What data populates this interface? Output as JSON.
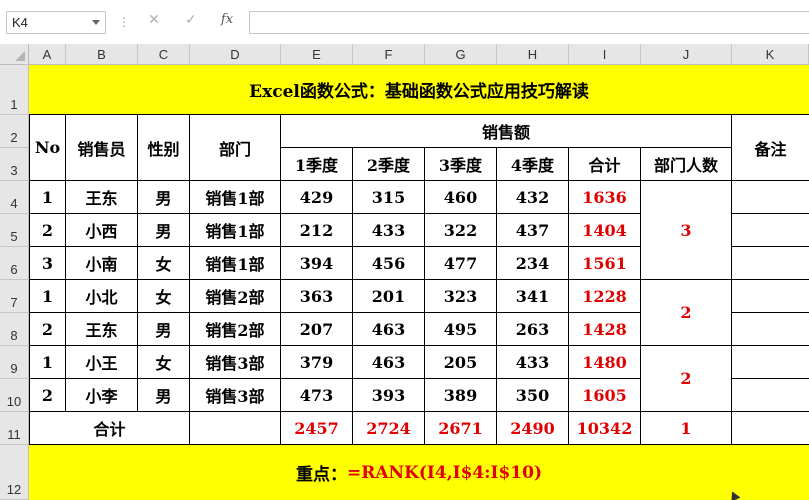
{
  "formula_bar": {
    "name_box": "K4",
    "separator": "⋮",
    "cancel_icon": "✕",
    "enter_icon": "✓",
    "fx_label": "fx",
    "formula": ""
  },
  "columns": [
    "A",
    "B",
    "C",
    "D",
    "E",
    "F",
    "G",
    "H",
    "I",
    "J",
    "K"
  ],
  "rows": [
    "1",
    "2",
    "3",
    "4",
    "5",
    "6",
    "7",
    "8",
    "9",
    "10",
    "11",
    "12"
  ],
  "sheet": {
    "title": "Excel函数公式：基础函数公式应用技巧解读",
    "headers": {
      "no": "No",
      "salesperson": "销售员",
      "gender": "性别",
      "department": "部门",
      "sales": "销售额",
      "q1": "1季度",
      "q2": "2季度",
      "q3": "3季度",
      "q4": "4季度",
      "total": "合计",
      "dept_count": "部门人数",
      "notes": "备注"
    },
    "records": [
      {
        "no": "1",
        "name": "王东",
        "gender": "男",
        "dept": "销售1部",
        "q1": "429",
        "q2": "315",
        "q3": "460",
        "q4": "432",
        "total": "1636"
      },
      {
        "no": "2",
        "name": "小西",
        "gender": "男",
        "dept": "销售1部",
        "q1": "212",
        "q2": "433",
        "q3": "322",
        "q4": "437",
        "total": "1404"
      },
      {
        "no": "3",
        "name": "小南",
        "gender": "女",
        "dept": "销售1部",
        "q1": "394",
        "q2": "456",
        "q3": "477",
        "q4": "234",
        "total": "1561"
      },
      {
        "no": "1",
        "name": "小北",
        "gender": "女",
        "dept": "销售2部",
        "q1": "363",
        "q2": "201",
        "q3": "323",
        "q4": "341",
        "total": "1228"
      },
      {
        "no": "2",
        "name": "王东",
        "gender": "男",
        "dept": "销售2部",
        "q1": "207",
        "q2": "463",
        "q3": "495",
        "q4": "263",
        "total": "1428"
      },
      {
        "no": "1",
        "name": "小王",
        "gender": "女",
        "dept": "销售3部",
        "q1": "379",
        "q2": "463",
        "q3": "205",
        "q4": "433",
        "total": "1480"
      },
      {
        "no": "2",
        "name": "小李",
        "gender": "男",
        "dept": "销售3部",
        "q1": "473",
        "q2": "393",
        "q3": "389",
        "q4": "350",
        "total": "1605"
      }
    ],
    "dept_counts": [
      "3",
      "2",
      "2"
    ],
    "summary": {
      "label": "合计",
      "q1": "2457",
      "q2": "2724",
      "q3": "2671",
      "q4": "2490",
      "total": "10342",
      "dept_count": "1"
    },
    "key_point": {
      "label": "重点：",
      "formula": "=RANK(I4,I$4:I$10)"
    }
  },
  "colors": {
    "highlight_fill": "#ffff00",
    "value_red": "#e00000",
    "header_gray": "#e6e6e6"
  }
}
